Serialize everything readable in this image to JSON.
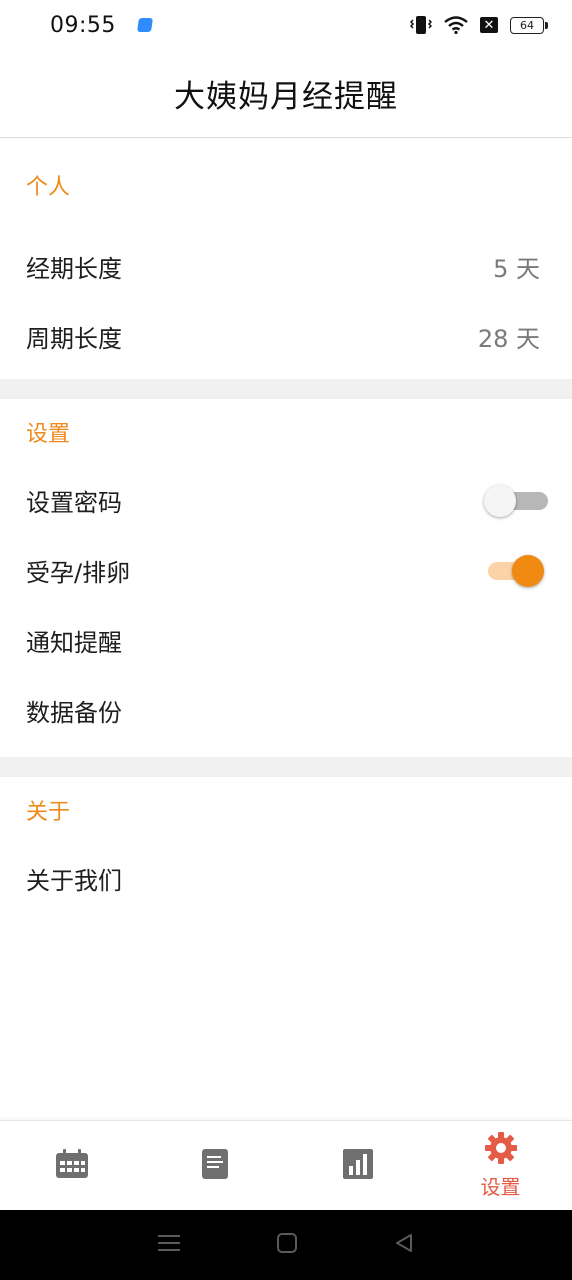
{
  "status_bar": {
    "time": "09:55",
    "battery": "64",
    "close_box": "✕",
    "icons": [
      "app-notification-icon",
      "vibrate-icon",
      "wifi-icon",
      "close-box-icon",
      "battery-icon"
    ]
  },
  "app_bar": {
    "title": "大姨妈月经提醒"
  },
  "sections": {
    "personal": {
      "header": "个人",
      "period_length_label": "经期长度",
      "period_length_value": "5 天",
      "cycle_length_label": "周期长度",
      "cycle_length_value": "28 天"
    },
    "settings": {
      "header": "设置",
      "password_label": "设置密码",
      "password_on": false,
      "pregnancy_label": "受孕/排卵",
      "pregnancy_on": true,
      "notification_label": "通知提醒",
      "backup_label": "数据备份"
    },
    "about": {
      "header": "关于",
      "about_us_label": "关于我们"
    }
  },
  "bottom_nav": {
    "items": [
      {
        "icon": "calendar-icon",
        "label": ""
      },
      {
        "icon": "notes-icon",
        "label": ""
      },
      {
        "icon": "chart-icon",
        "label": ""
      },
      {
        "icon": "gear-icon",
        "label": "设置",
        "active": true
      }
    ]
  },
  "colors": {
    "accent": "#ee8a1b",
    "switch_on": "#f08a12",
    "nav_active": "#e45b46",
    "nav_inactive": "#6f6f6f"
  }
}
